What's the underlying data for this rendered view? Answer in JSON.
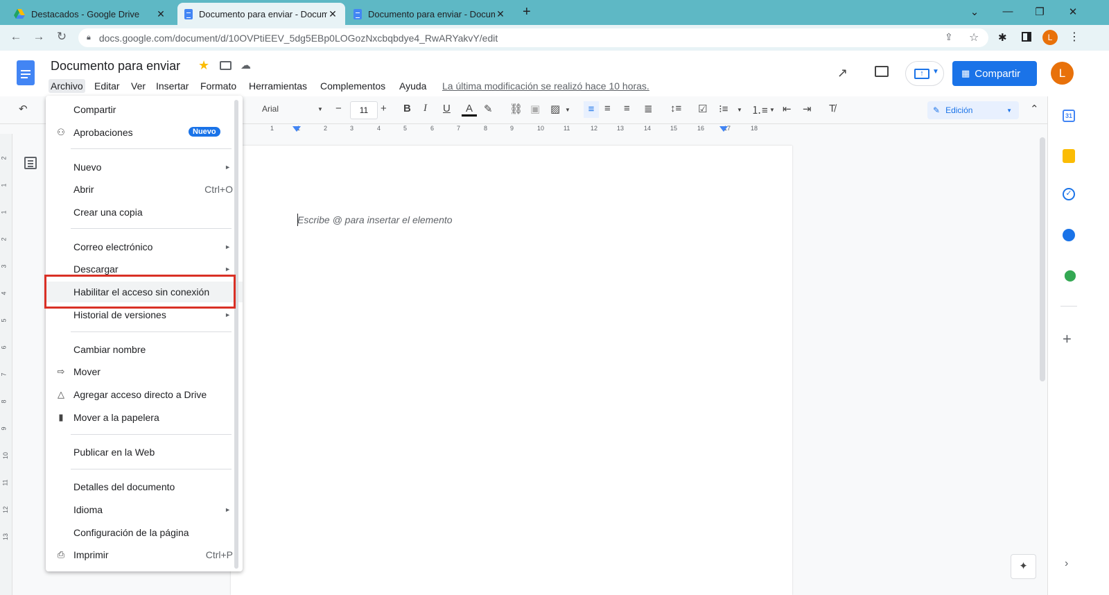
{
  "browser": {
    "tabs": [
      {
        "title": "Destacados - Google Drive"
      },
      {
        "title": "Documento para enviar - Docum"
      },
      {
        "title": "Documento para enviar - Docum"
      }
    ],
    "url": "docs.google.com/document/d/10OVPtiEEV_5dg5EBp0LOGozNxcbqbdye4_RwARYakvY/edit",
    "profile_initial": "L"
  },
  "doc": {
    "title": "Documento para enviar",
    "menu": [
      "Archivo",
      "Editar",
      "Ver",
      "Insertar",
      "Formato",
      "Herramientas",
      "Complementos",
      "Ayuda"
    ],
    "last_edit": "La última modificación se realizó hace 10 horas.",
    "share_label": "Compartir",
    "avatar_initial": "L"
  },
  "toolbar": {
    "font": "Arial",
    "font_size": "11",
    "mode": "Edición",
    "minus": "−",
    "plus": "+"
  },
  "ruler": [
    "1",
    "1",
    "2",
    "3",
    "4",
    "5",
    "6",
    "7",
    "8",
    "9",
    "10",
    "11",
    "12",
    "13",
    "14",
    "15",
    "16",
    "17",
    "18"
  ],
  "vruler": [
    "2",
    "1",
    "1",
    "2",
    "3",
    "4",
    "5",
    "6",
    "7",
    "8",
    "9",
    "10",
    "11",
    "12",
    "13"
  ],
  "page": {
    "placeholder": "Escribe @ para insertar el elemento"
  },
  "file_menu": {
    "share": "Compartir",
    "approvals": "Aprobaciones",
    "approvals_badge": "Nuevo",
    "new": "Nuevo",
    "open": "Abrir",
    "open_shortcut": "Ctrl+O",
    "copy": "Crear una copia",
    "email": "Correo electrónico",
    "download": "Descargar",
    "offline": "Habilitar el acceso sin conexión",
    "history": "Historial de versiones",
    "rename": "Cambiar nombre",
    "move": "Mover",
    "shortcut": "Agregar acceso directo a Drive",
    "trash": "Mover a la papelera",
    "publish": "Publicar en la Web",
    "details": "Detalles del documento",
    "language": "Idioma",
    "page_setup": "Configuración de la página",
    "print": "Imprimir",
    "print_shortcut": "Ctrl+P"
  },
  "colors": {
    "tabbar": "#5eb8c5",
    "accent": "#1a73e8",
    "highlight_box": "#d93025",
    "avatar": "#e8710a"
  }
}
